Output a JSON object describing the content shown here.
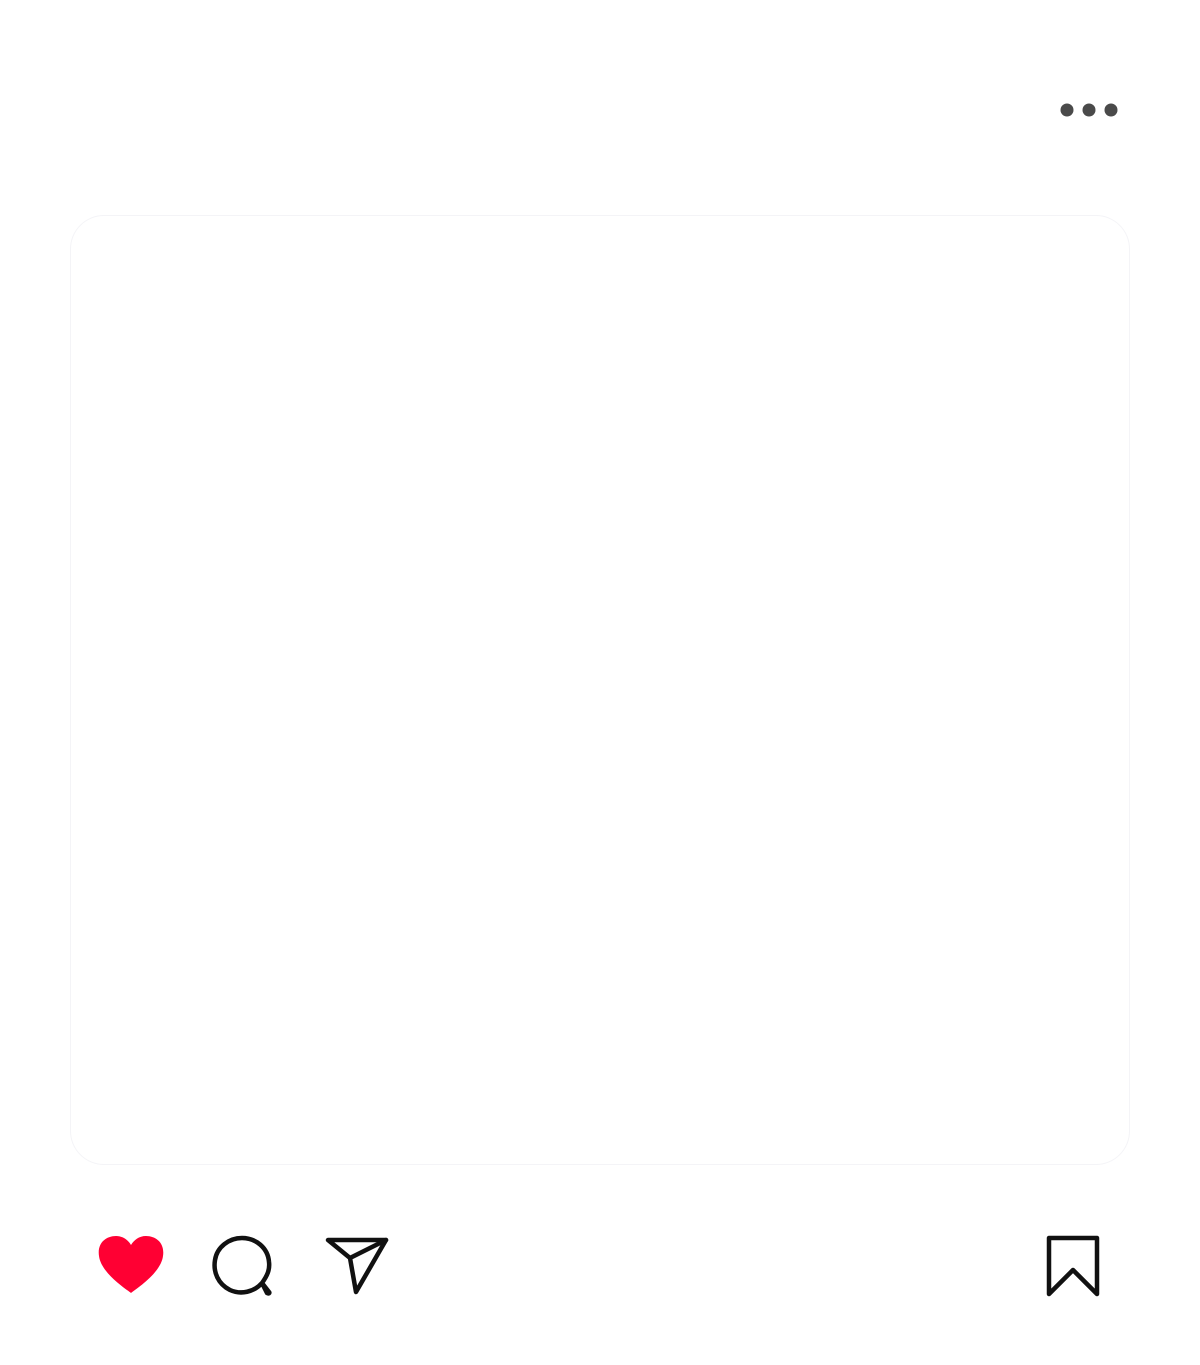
{
  "icons": {
    "more": "more-horizontal-icon",
    "like": "heart-filled-icon",
    "comment": "speech-bubble-icon",
    "share": "paper-plane-icon",
    "save": "bookmark-icon"
  },
  "colors": {
    "like_active": "#ff0033",
    "icon_stroke": "#111111",
    "more_dots": "#4a4a4a",
    "background": "#ffffff"
  },
  "state": {
    "liked": true,
    "saved": false
  }
}
